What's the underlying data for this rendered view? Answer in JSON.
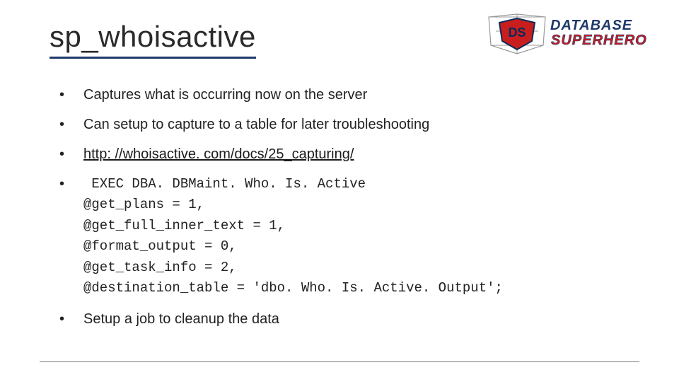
{
  "title": "sp_whoisactive",
  "logo": {
    "text_top": "DATABASE",
    "text_bottom": "SUPERHERO",
    "badge": "DS",
    "color_primary": "#c81e1e",
    "color_secondary": "#1f3a6b"
  },
  "bullets": [
    {
      "type": "text",
      "text": "Captures what is occurring now on the server"
    },
    {
      "type": "text",
      "text": "Can setup to capture to a table for later troubleshooting"
    },
    {
      "type": "link",
      "text": "http: //whoisactive. com/docs/25_capturing/"
    },
    {
      "type": "code",
      "lines": [
        " EXEC DBA. DBMaint. Who. Is. Active",
        "@get_plans = 1,",
        "@get_full_inner_text = 1,",
        "@format_output = 0,",
        "@get_task_info = 2,",
        "@destination_table = 'dbo. Who. Is. Active. Output';"
      ]
    },
    {
      "type": "text",
      "text": "Setup a job to cleanup the data"
    }
  ]
}
